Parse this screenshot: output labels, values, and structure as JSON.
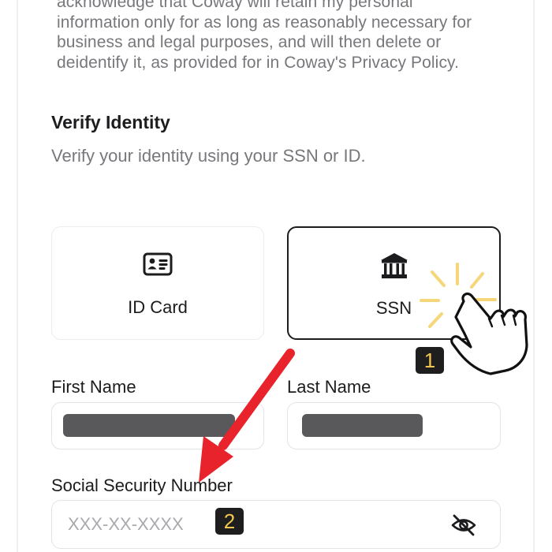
{
  "consent": {
    "lines": [
      "acknowledge that Coway will retain my personal",
      "information only for as long as reasonably necessary for",
      "business and legal purposes, and will then delete or",
      "deidentify it, as provided for in Coway's Privacy Policy."
    ]
  },
  "verify": {
    "title": "Verify Identity",
    "subtitle": "Verify your identity using your SSN or ID."
  },
  "options": [
    {
      "label": "ID Card",
      "icon": "id-card-icon",
      "selected": false
    },
    {
      "label": "SSN",
      "icon": "bank-icon",
      "selected": true
    }
  ],
  "fields": {
    "first_name": {
      "label": "First Name",
      "redacted": true
    },
    "last_name": {
      "label": "Last Name",
      "redacted": true
    },
    "ssn": {
      "label": "Social Security Number",
      "placeholder": "XXX-XX-XXXX",
      "value": "",
      "toggle_icon": "eye-slash-icon"
    }
  },
  "annotations": {
    "step1": "1",
    "step2": "2",
    "arrow_color": "#e8232b",
    "sparkle_color": "#f5d77a",
    "badge_text_color": "#f3c64f"
  }
}
